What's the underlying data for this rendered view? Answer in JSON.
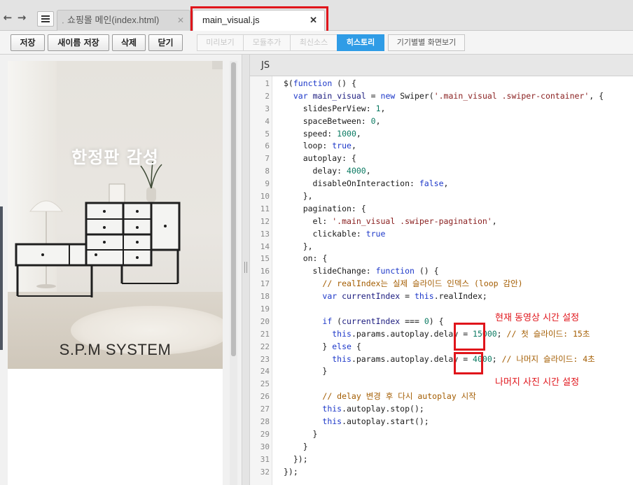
{
  "tabs": [
    {
      "label": "쇼핑몰 메인(index.html)",
      "close_icon": "close-icon",
      "active": false
    },
    {
      "label": "main_visual.js",
      "close_icon": "close-icon",
      "active": true
    }
  ],
  "toolbar": {
    "buttons": [
      "저장",
      "새이름 저장",
      "삭제",
      "닫기"
    ],
    "segments": [
      "미리보기",
      "모듈추가",
      "최신소스",
      "히스토리"
    ],
    "active_segment": "히스토리",
    "device_button": "기기별별 화면보기"
  },
  "preview": {
    "overlay_title": "한정판 감성",
    "brand": "S.P.M SYSTEM"
  },
  "editor": {
    "language": "JS",
    "lines": [
      "$(function () {",
      "  var main_visual = new Swiper('.main_visual .swiper-container', {",
      "    slidesPerView: 1,",
      "    spaceBetween: 0,",
      "    speed: 1000,",
      "    loop: true,",
      "    autoplay: {",
      "      delay: 4000,",
      "      disableOnInteraction: false,",
      "    },",
      "    pagination: {",
      "      el: '.main_visual .swiper-pagination',",
      "      clickable: true",
      "    },",
      "    on: {",
      "      slideChange: function () {",
      "        // realIndex는 실제 슬라이드 인덱스 (loop 감안)",
      "        var currentIndex = this.realIndex;",
      "",
      "        if (currentIndex === 0) {",
      "          this.params.autoplay.delay = 15000; // 첫 슬라이드: 15초",
      "        } else {",
      "          this.params.autoplay.delay = 4000; // 나머지 슬라이드: 4초",
      "        }",
      "",
      "        // delay 변경 후 다시 autoplay 시작",
      "        this.autoplay.stop();",
      "        this.autoplay.start();",
      "      }",
      "    }",
      "  });",
      "});"
    ]
  },
  "annotations": {
    "video_time": "현재 동영상 시간 설정",
    "photo_time": "나머지 사진 시간 설정"
  },
  "colors": {
    "highlight": "#e0151b",
    "accent": "#2f9ce6"
  }
}
